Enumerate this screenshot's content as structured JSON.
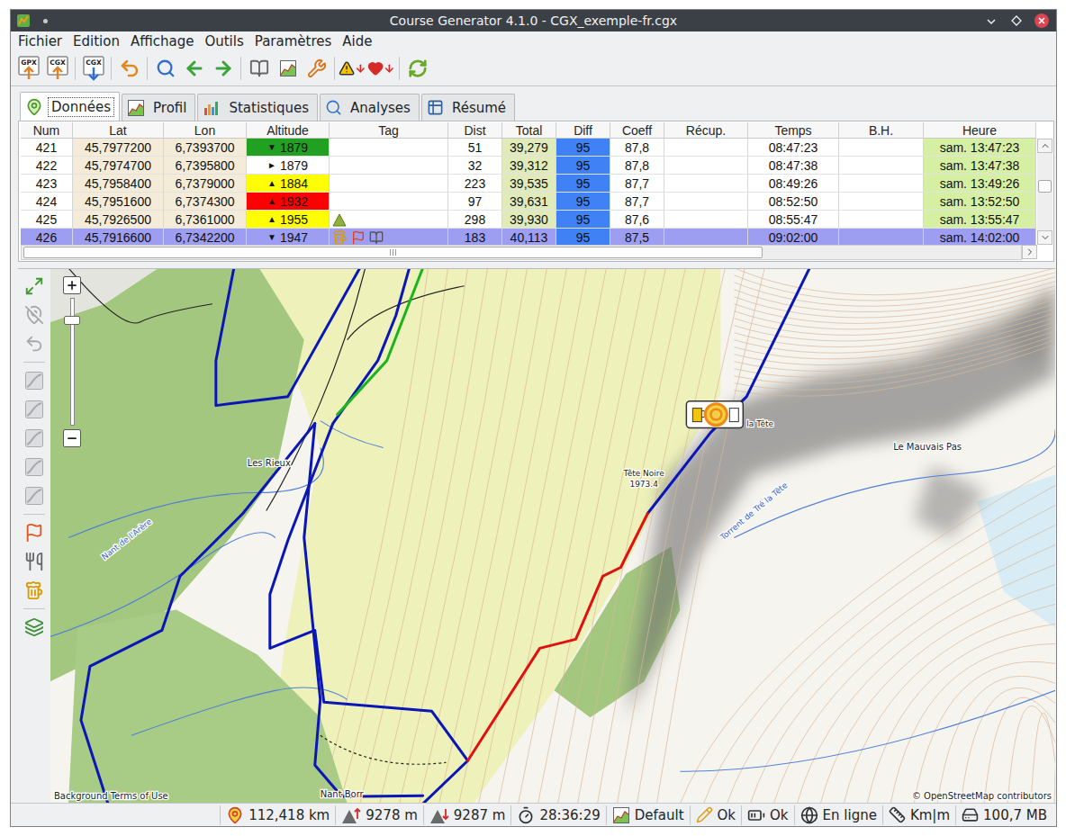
{
  "window": {
    "title": "Course Generator 4.1.0 - CGX_exemple-fr.cgx"
  },
  "menu": [
    {
      "label": "Fichier"
    },
    {
      "label": "Edition"
    },
    {
      "label": "Affichage"
    },
    {
      "label": "Outils"
    },
    {
      "label": "Paramètres"
    },
    {
      "label": "Aide"
    }
  ],
  "toolbar": {
    "file_buttons": [
      {
        "label": "GPX",
        "kind": "open"
      },
      {
        "label": "CGX",
        "kind": "open"
      },
      {
        "label": "CGX",
        "kind": "save"
      }
    ]
  },
  "tabs": [
    {
      "label": "Données",
      "kind": "data",
      "selected": true
    },
    {
      "label": "Profil",
      "kind": "profile",
      "selected": false
    },
    {
      "label": "Statistiques",
      "kind": "statistics",
      "selected": false
    },
    {
      "label": "Analyses",
      "kind": "analysis",
      "selected": false
    },
    {
      "label": "Résumé",
      "kind": "summary",
      "selected": false
    }
  ],
  "table": {
    "columns": [
      "Num",
      "Lat",
      "Lon",
      "Altitude",
      "Tag",
      "Dist",
      "Total",
      "Diff",
      "Coeff",
      "Récup.",
      "Temps",
      "B.H.",
      "Heure"
    ],
    "rows": [
      {
        "num": "421",
        "lat": "45,7977200",
        "lon": "6,7393700",
        "trend": "▼",
        "altitude": "1879",
        "alt_color": "#22a022",
        "tags": [],
        "dist": "51",
        "total": "39,279",
        "diff": "95",
        "coeff": "87,8",
        "recup": "",
        "temps": "08:47:23",
        "bh": "",
        "heure": "sam. 13:47:23",
        "selected": false
      },
      {
        "num": "422",
        "lat": "45,7974700",
        "lon": "6,7395800",
        "trend": "►",
        "altitude": "1879",
        "alt_color": "#ffffff",
        "tags": [],
        "dist": "32",
        "total": "39,312",
        "diff": "95",
        "coeff": "87,8",
        "recup": "",
        "temps": "08:47:38",
        "bh": "",
        "heure": "sam. 13:47:38",
        "selected": false
      },
      {
        "num": "423",
        "lat": "45,7958400",
        "lon": "6,7379000",
        "trend": "▲",
        "altitude": "1884",
        "alt_color": "#ffff00",
        "tags": [],
        "dist": "223",
        "total": "39,535",
        "diff": "95",
        "coeff": "87,7",
        "recup": "",
        "temps": "08:49:26",
        "bh": "",
        "heure": "sam. 13:49:26",
        "selected": false
      },
      {
        "num": "424",
        "lat": "45,7951600",
        "lon": "6,7374300",
        "trend": "▲",
        "altitude": "1932",
        "alt_color": "#ff0000",
        "tags": [],
        "dist": "97",
        "total": "39,631",
        "diff": "95",
        "coeff": "87,7",
        "recup": "",
        "temps": "08:52:50",
        "bh": "",
        "heure": "sam. 13:52:50",
        "selected": false
      },
      {
        "num": "425",
        "lat": "45,7926500",
        "lon": "6,7361000",
        "trend": "▲",
        "altitude": "1955",
        "alt_color": "#ffff00",
        "tags": [
          "peak"
        ],
        "dist": "298",
        "total": "39,930",
        "diff": "95",
        "coeff": "87,6",
        "recup": "",
        "temps": "08:55:47",
        "bh": "",
        "heure": "sam. 13:55:47",
        "selected": false
      },
      {
        "num": "426",
        "lat": "45,7916600",
        "lon": "6,7342200",
        "trend": "▼",
        "altitude": "1947",
        "alt_color": "",
        "tags": [
          "drink",
          "flag",
          "note"
        ],
        "dist": "183",
        "total": "40,113",
        "diff": "95",
        "coeff": "87,5",
        "recup": "",
        "temps": "09:02:00",
        "bh": "",
        "heure": "sam. 14:02:00",
        "selected": true
      }
    ],
    "scrollbars": {
      "horizontal": {
        "level": 0.74
      },
      "vertical": {
        "level": 0.41
      }
    }
  },
  "map": {
    "zoom": {
      "level": 0.83
    },
    "tools": [
      {
        "kind": "fit",
        "disabled": false
      },
      {
        "kind": "hide-point",
        "disabled": true
      },
      {
        "kind": "undo",
        "disabled": true
      },
      {
        "kind": "curve",
        "disabled": true
      },
      {
        "kind": "curve",
        "disabled": true
      },
      {
        "kind": "curve",
        "disabled": true
      },
      {
        "kind": "curve",
        "disabled": true
      },
      {
        "kind": "curve",
        "disabled": true
      },
      {
        "kind": "flag",
        "disabled": false
      },
      {
        "kind": "food",
        "disabled": false
      },
      {
        "kind": "drink",
        "disabled": false
      },
      {
        "kind": "layers",
        "disabled": false
      }
    ],
    "marker": {
      "kind": "drink",
      "selected": true
    },
    "labels": [
      {
        "text": "Les Rieux",
        "kind": "place"
      },
      {
        "text": "Nant de l'Arère",
        "kind": "water"
      },
      {
        "text": "Tête Noire",
        "kind": "place"
      },
      {
        "text": "1973.4",
        "kind": "place"
      },
      {
        "text": "la Tête",
        "kind": "place"
      },
      {
        "text": "Le Mauvais Pas",
        "kind": "place"
      },
      {
        "text": "Torrent de Tré la Tête",
        "kind": "water"
      },
      {
        "text": "Nant Borr",
        "kind": "place"
      }
    ],
    "attribution": {
      "left": "Background Terms of Use",
      "right": "© OpenStreetMap contributors"
    }
  },
  "status_bar": [
    {
      "kind": "distance",
      "text": "112,418 km"
    },
    {
      "kind": "climb",
      "text": "9278 m"
    },
    {
      "kind": "descent",
      "text": "9287 m"
    },
    {
      "kind": "time",
      "text": "28:36:29"
    },
    {
      "kind": "curve",
      "text": "Default"
    },
    {
      "kind": "edit",
      "text": "Ok"
    },
    {
      "kind": "battery",
      "text": "Ok"
    },
    {
      "kind": "network",
      "text": "En ligne"
    },
    {
      "kind": "units",
      "text": "Km|m"
    },
    {
      "kind": "memory",
      "text": "100,7 MB"
    }
  ]
}
